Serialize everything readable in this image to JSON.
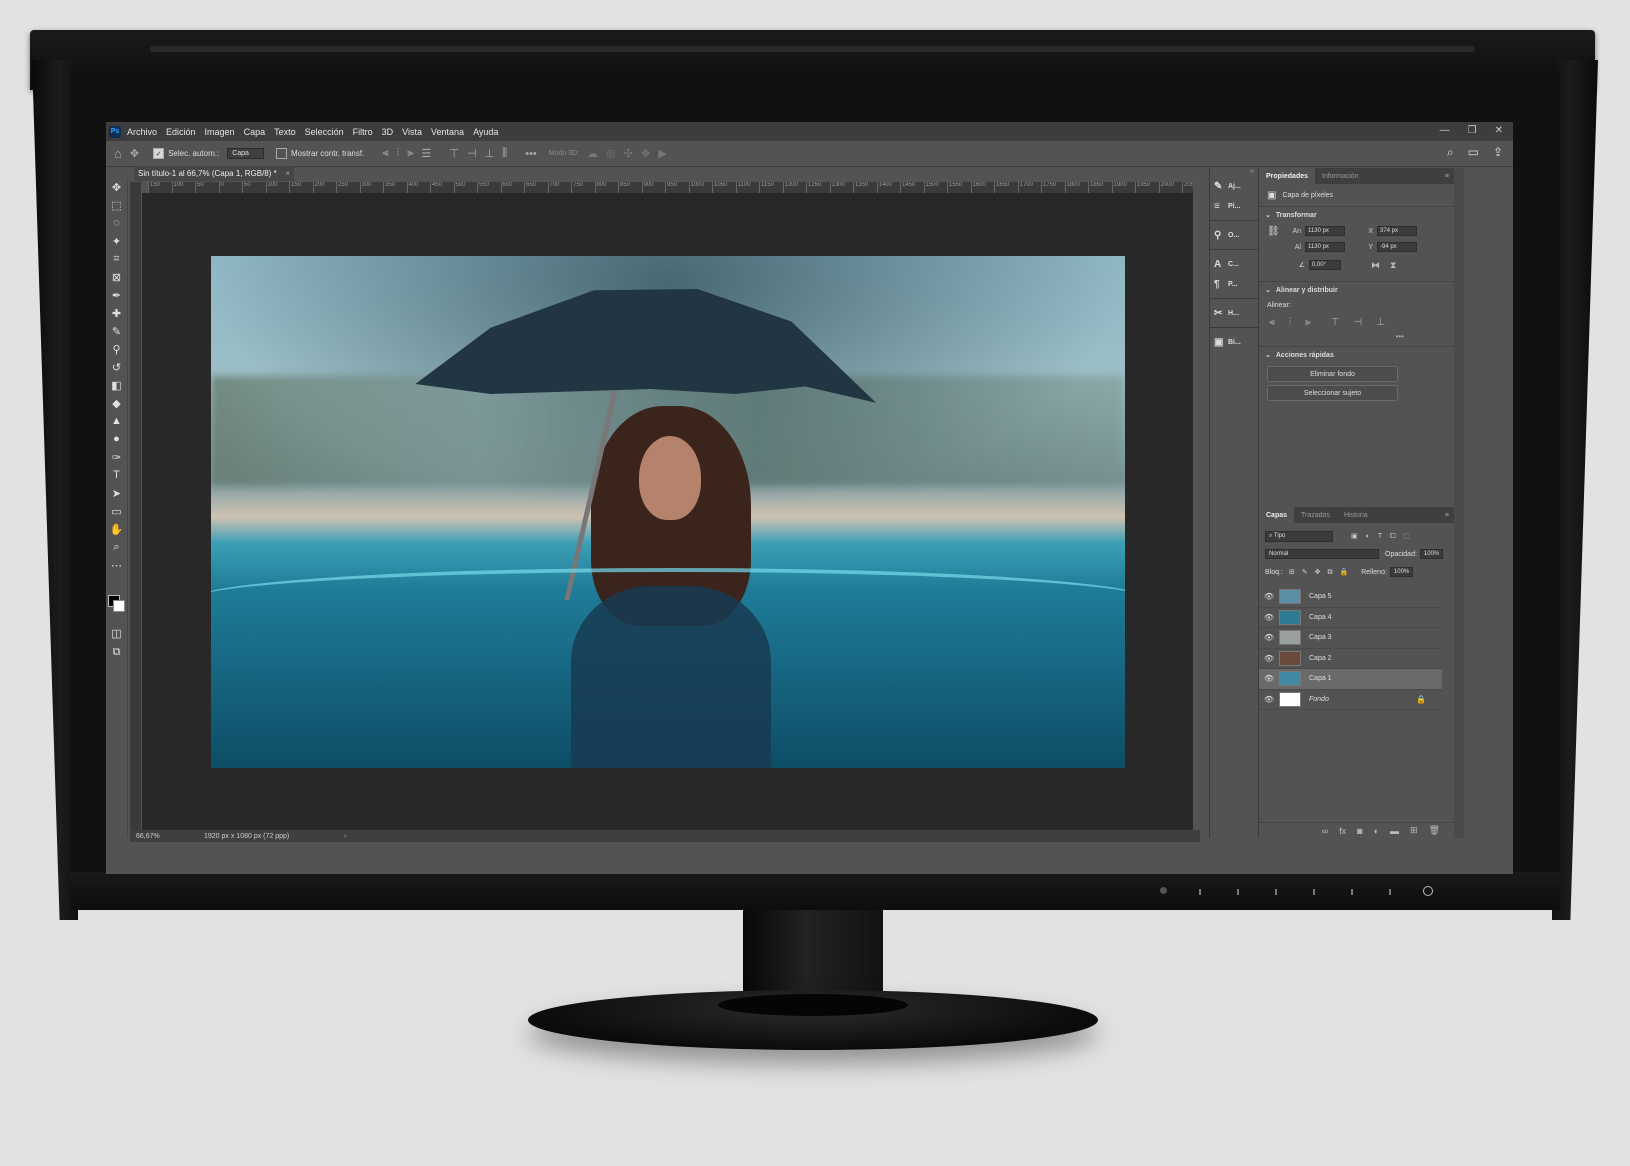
{
  "app": {
    "logo": "Ps",
    "menu": [
      "Archivo",
      "Edición",
      "Imagen",
      "Capa",
      "Texto",
      "Selección",
      "Filtro",
      "3D",
      "Vista",
      "Ventana",
      "Ayuda"
    ],
    "window_controls": [
      "—",
      "❐",
      "✕"
    ]
  },
  "options_bar": {
    "auto_select_label": "Selec. autom.:",
    "auto_select_target": "Capa",
    "show_transform_label": "Mostrar contr. transf.",
    "mode_3d_label": "Modo 3D:"
  },
  "document": {
    "tab_title": "Sin título-1 al 66,7% (Capa 1, RGB/8) *",
    "ruler_ticks": [
      "150",
      "100",
      "50",
      "0",
      "50",
      "100",
      "150",
      "200",
      "250",
      "300",
      "350",
      "400",
      "450",
      "500",
      "550",
      "600",
      "650",
      "700",
      "750",
      "800",
      "850",
      "900",
      "950",
      "1000",
      "1050",
      "1100",
      "1150",
      "1200",
      "1250",
      "1300",
      "1350",
      "1400",
      "1450",
      "1500",
      "1550",
      "1600",
      "1650",
      "1700",
      "1750",
      "1800",
      "1850",
      "1900",
      "1950",
      "2000",
      "205"
    ],
    "zoom": "66,67%",
    "doc_info": "1920 px x 1080 px (72 ppp)"
  },
  "mini_panels": [
    {
      "icon": "brush-icon",
      "glyph": "✎",
      "label": "Aj..."
    },
    {
      "icon": "sliders-icon",
      "glyph": "≡",
      "label": "Pi..."
    },
    {
      "icon": "stamp-icon",
      "glyph": "⚲",
      "label": "O..."
    },
    {
      "icon": "character-icon",
      "glyph": "A",
      "label": "C..."
    },
    {
      "icon": "paragraph-icon",
      "glyph": "¶",
      "label": "P..."
    },
    {
      "icon": "tools-icon",
      "glyph": "✂",
      "label": "H..."
    },
    {
      "icon": "library-icon",
      "glyph": "▣",
      "label": "Bi..."
    }
  ],
  "properties": {
    "tabs": [
      "Propiedades",
      "Información"
    ],
    "layer_type": "Capa de píxeles",
    "transform_title": "Transformar",
    "width_label": "An",
    "width_value": "1130 px",
    "height_label": "Al",
    "height_value": "1130 px",
    "x_label": "X",
    "x_value": "374 px",
    "y_label": "Y",
    "y_value": "-94 px",
    "angle_value": "0,00°",
    "align_title": "Alinear y distribuir",
    "align_label": "Alinear:",
    "quick_actions_title": "Acciones rápidas",
    "remove_bg_button": "Eliminar fondo",
    "select_subject_button": "Seleccionar sujeto"
  },
  "layers": {
    "tabs": [
      "Capas",
      "Trazados",
      "Historia"
    ],
    "filter": "Tipo",
    "blend_mode": "Normal",
    "opacity_label": "Opacidad:",
    "opacity_value": "100%",
    "lock_label": "Bloq.:",
    "fill_label": "Relleno:",
    "fill_value": "100%",
    "items": [
      {
        "name": "Capa 5",
        "thumb": "#5a8fa5",
        "selected": false
      },
      {
        "name": "Capa 4",
        "thumb": "#2d7c93",
        "selected": false
      },
      {
        "name": "Capa 3",
        "thumb": "#9aa0a0",
        "selected": false
      },
      {
        "name": "Capa 2",
        "thumb": "#6b4a3d",
        "selected": false
      },
      {
        "name": "Capa 1",
        "thumb": "#3f8aa2",
        "selected": true
      },
      {
        "name": "Fondo",
        "thumb": "#ffffff",
        "selected": false
      }
    ]
  }
}
